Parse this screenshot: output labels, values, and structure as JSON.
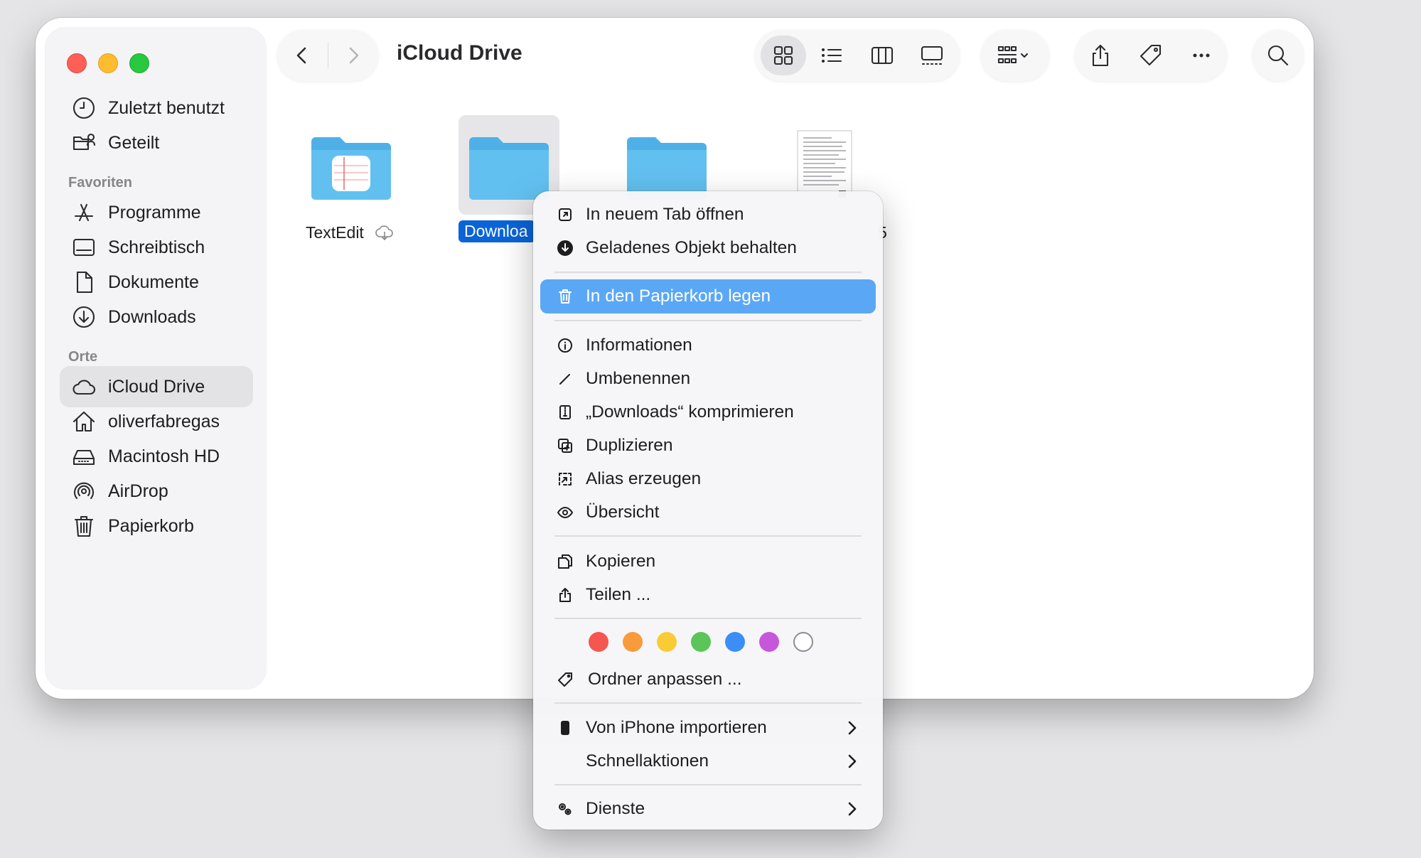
{
  "window": {
    "title": "iCloud Drive"
  },
  "sidebar": {
    "top_items": [
      {
        "label": "Zuletzt benutzt",
        "icon": "clock-icon"
      },
      {
        "label": "Geteilt",
        "icon": "shared-folder-icon"
      }
    ],
    "favorites_title": "Favoriten",
    "favorites": [
      {
        "label": "Programme",
        "icon": "apps-icon"
      },
      {
        "label": "Schreibtisch",
        "icon": "desktop-icon"
      },
      {
        "label": "Dokumente",
        "icon": "document-icon"
      },
      {
        "label": "Downloads",
        "icon": "download-icon"
      }
    ],
    "places_title": "Orte",
    "places": [
      {
        "label": "iCloud Drive",
        "icon": "cloud-icon",
        "active": true
      },
      {
        "label": "oliverfabregas",
        "icon": "home-icon"
      },
      {
        "label": "Macintosh HD",
        "icon": "disk-icon"
      },
      {
        "label": "AirDrop",
        "icon": "airdrop-icon"
      },
      {
        "label": "Papierkorb",
        "icon": "trash-icon"
      }
    ]
  },
  "files": [
    {
      "label": "TextEdit",
      "icon": "textedit-folder-icon",
      "cloud": true
    },
    {
      "label": "Downloa",
      "icon": "folder-icon",
      "selected": true
    },
    {
      "label": "",
      "icon": "folder-icon"
    },
    {
      "label": "5",
      "icon": "pdf-document-icon"
    }
  ],
  "context_menu": {
    "items": [
      {
        "label": "In neuem Tab öffnen",
        "icon": "new-tab-icon"
      },
      {
        "label": "Geladenes Objekt behalten",
        "icon": "download-circle-icon"
      },
      {
        "label": "In den Papierkorb legen",
        "icon": "trash-icon",
        "highlighted": true
      },
      {
        "label": "Informationen",
        "icon": "info-icon"
      },
      {
        "label": "Umbenennen",
        "icon": "pencil-icon"
      },
      {
        "label": "„Downloads“ komprimieren",
        "icon": "archive-icon"
      },
      {
        "label": "Duplizieren",
        "icon": "duplicate-icon"
      },
      {
        "label": "Alias erzeugen",
        "icon": "alias-icon"
      },
      {
        "label": "Übersicht",
        "icon": "eye-icon"
      },
      {
        "label": "Kopieren",
        "icon": "copy-icon"
      },
      {
        "label": "Teilen ...",
        "icon": "share-icon"
      },
      {
        "label": "Ordner anpassen ...",
        "icon": "tag-icon"
      },
      {
        "label": "Von iPhone importieren",
        "icon": "iphone-icon",
        "submenu": true
      },
      {
        "label": "Schnellaktionen",
        "icon": "",
        "submenu": true
      },
      {
        "label": "Dienste",
        "icon": "gears-icon",
        "submenu": true
      }
    ],
    "tag_colors": [
      "#f5564f",
      "#f99a3c",
      "#f9cc36",
      "#5ac559",
      "#3b8ef5",
      "#c657db",
      "none"
    ]
  },
  "colors": {
    "accent": "#0a64d8",
    "highlight": "#5aa8f5"
  }
}
